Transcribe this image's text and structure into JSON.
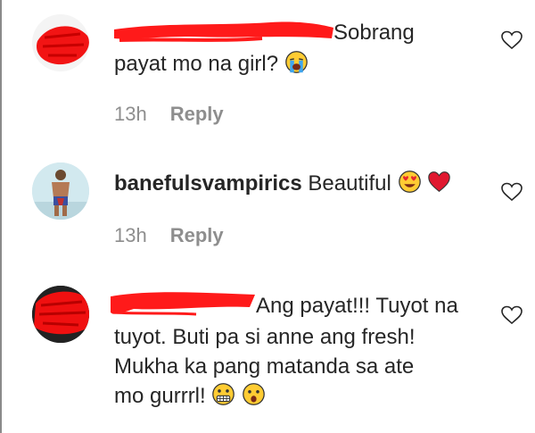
{
  "comments": [
    {
      "username": "",
      "text": "Sobrang",
      "text_line2": "payat mo na girl?",
      "emojis": [
        "loudly-crying-face-emoji"
      ],
      "time": "13h",
      "reply_label": "Reply",
      "redacted": true
    },
    {
      "username": "banefulsvampirics",
      "text": "Beautiful",
      "emojis": [
        "heart-eyes-emoji",
        "red-heart-emoji"
      ],
      "time": "13h",
      "reply_label": "Reply",
      "redacted": false
    },
    {
      "username": "",
      "text": "Ang payat!!! Tuyot na",
      "text_line2": "tuyot. Buti pa si anne ang fresh!",
      "text_line3": "Mukha ka pang matanda sa ate",
      "text_line4": "mo gurrrl!",
      "emojis": [
        "grimacing-face-emoji",
        "astonished-face-emoji"
      ],
      "redacted": true
    }
  ],
  "colors": {
    "text": "#262626",
    "meta": "#8e8e8e",
    "redaction": "#ff0000"
  }
}
